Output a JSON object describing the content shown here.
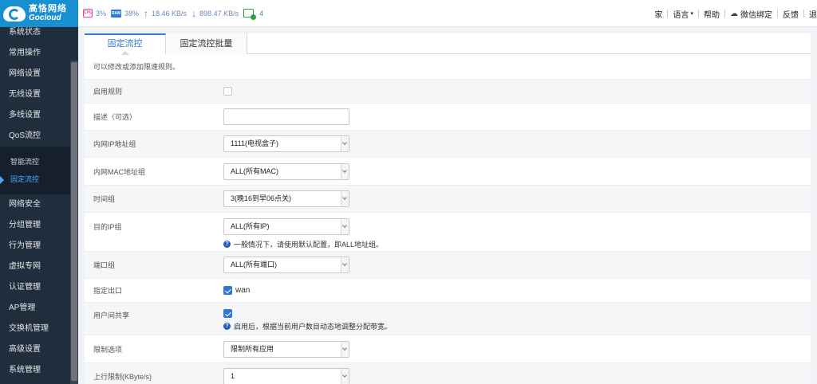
{
  "brand": {
    "name_cn": "高恪网络",
    "name_en": "Gocloud"
  },
  "topbar": {
    "cpu_label": "CPU",
    "cpu": "3%",
    "ram_label": "RAM",
    "ram": "38%",
    "upload": "18.46 KB/s",
    "download": "898.47 KB/s",
    "devices": "4",
    "right": {
      "user": "家",
      "language": "语言",
      "help": "帮助",
      "wechat": "微信绑定",
      "feedback": "反馈",
      "cut": "退"
    }
  },
  "sidebar": {
    "items": [
      "系统状态",
      "常用操作",
      "网络设置",
      "无线设置",
      "多线设置",
      "QoS流控"
    ],
    "sub_items": [
      "智能流控",
      "固定流控"
    ],
    "items_after": [
      "网络安全",
      "分组管理",
      "行为管理",
      "虚拟专网",
      "认证管理",
      "AP管理",
      "交换机管理",
      "高级设置",
      "系统管理"
    ]
  },
  "tabs": [
    "固定流控",
    "固定流控批量"
  ],
  "description": "可以修改或添加限速规则。",
  "form": {
    "enable": {
      "label": "启用规则"
    },
    "desc": {
      "label": "描述（可选）",
      "value": ""
    },
    "ip_group": {
      "label": "内网IP地址组",
      "value": "1111(电视盒子)"
    },
    "mac_group": {
      "label": "内网MAC地址组",
      "value": "ALL(所有MAC)"
    },
    "time_group": {
      "label": "时间组",
      "value": "3(晚16到早06点关)"
    },
    "dest_ip": {
      "label": "目的IP组",
      "value": "ALL(所有IP)",
      "hint": "一般情况下，请使用默认配置，即ALL地址组。"
    },
    "port_group": {
      "label": "端口组",
      "value": "ALL(所有端口)"
    },
    "outlet": {
      "label": "指定出口",
      "option": "wan"
    },
    "share": {
      "label": "用户间共享",
      "hint": "启用后，根据当前用户数目动态地调整分配带宽。"
    },
    "limit_option": {
      "label": "限制选项",
      "value": "限制所有应用"
    },
    "upload_limit": {
      "label": "上行限制(KByte/s)",
      "value": "1"
    }
  }
}
